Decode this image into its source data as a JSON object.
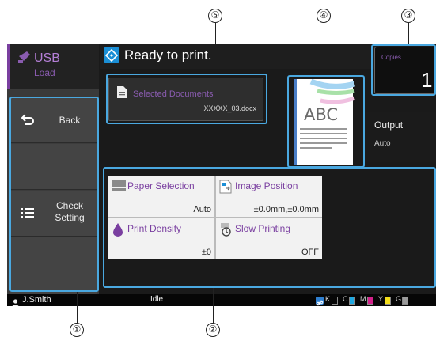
{
  "callouts": [
    "①",
    "②",
    "③",
    "④",
    "⑤"
  ],
  "sidebar": {
    "title": "USB",
    "subtitle": "Load",
    "items": [
      {
        "label": "Back",
        "icon": "back-arrow-icon"
      },
      {
        "label": "Check Setting",
        "icon": "list-icon"
      }
    ]
  },
  "header": {
    "status_text": "Ready to print.",
    "icon": "ready-diamond-icon"
  },
  "document": {
    "label": "Selected Documents",
    "filename": "XXXXX_03.docx",
    "icon": "document-icon"
  },
  "preview": {
    "text": "ABC"
  },
  "copies": {
    "label": "Copies",
    "value": "1"
  },
  "output": {
    "label": "Output",
    "value": "Auto"
  },
  "functions": [
    {
      "label": "Paper Selection",
      "value": "Auto",
      "icon": "paper-tray-icon"
    },
    {
      "label": "Image Position",
      "value": "±0.0mm,±0.0mm",
      "icon": "image-position-icon"
    },
    {
      "label": "Print Density",
      "value": "±0",
      "icon": "ink-drop-icon"
    },
    {
      "label": "Slow Printing",
      "value": "OFF",
      "icon": "slow-printing-icon"
    }
  ],
  "status_bar": {
    "user": "J.Smith",
    "state": "Idle",
    "inks": [
      {
        "label": "K",
        "color": "#000000",
        "level": 0.0
      },
      {
        "label": "C",
        "color": "#1fa8e0",
        "level": 1.0
      },
      {
        "label": "M",
        "color": "#d4208a",
        "level": 1.0
      },
      {
        "label": "Y",
        "color": "#f2dc1a",
        "level": 1.0
      },
      {
        "label": "G",
        "color": "#9a9a9a",
        "level": 1.0
      }
    ]
  },
  "colors": {
    "accent_purple": "#7a3fa0",
    "highlight_blue": "#4aa8e0"
  }
}
